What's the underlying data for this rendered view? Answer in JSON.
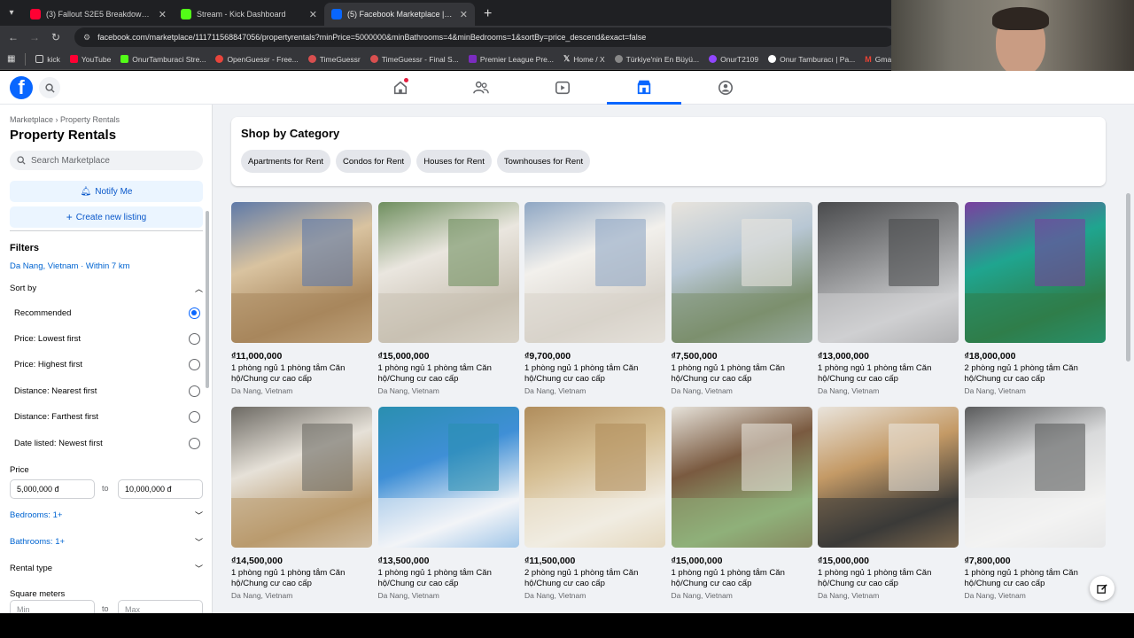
{
  "browser": {
    "tabs": [
      {
        "title": "(3) Fallout S2E5 Breakdown of T",
        "favicon_color": "#ff0033",
        "active": false
      },
      {
        "title": "Stream - Kick Dashboard",
        "favicon_color": "#53fc18",
        "active": false
      },
      {
        "title": "(5) Facebook Marketplace | Fac",
        "favicon_color": "#0866ff",
        "active": true
      }
    ],
    "url": "facebook.com/marketplace/111711568847056/propertyrentals?minPrice=5000000&minBathrooms=4&minBedrooms=1&sortBy=price_descend&exact=false",
    "bookmarks": [
      {
        "label": "kick",
        "color": "#53fc18"
      },
      {
        "label": "YouTube",
        "color": "#ff0033"
      },
      {
        "label": "OnurTamburaci Stre...",
        "color": "#53fc18"
      },
      {
        "label": "OpenGuessr - Free...",
        "color": "#e8453c"
      },
      {
        "label": "TimeGuessr",
        "color": "#d94f4f"
      },
      {
        "label": "TimeGuessr - Final S...",
        "color": "#d94f4f"
      },
      {
        "label": "Premier League Pre...",
        "color": "#7b2cbf"
      },
      {
        "label": "Home / X",
        "color": "#000000"
      },
      {
        "label": "Türkiye'nin En Büyü...",
        "color": "#888888"
      },
      {
        "label": "OnurT2109",
        "color": "#9146ff"
      },
      {
        "label": "Onur Tamburacı | Pa...",
        "color": "#000000"
      },
      {
        "label": "Gmail",
        "color": "#ea4335"
      }
    ]
  },
  "sidebar": {
    "breadcrumb": "Marketplace › Property Rentals",
    "title": "Property Rentals",
    "search_placeholder": "Search Marketplace",
    "notify_label": "Notify Me",
    "create_label": "Create new listing",
    "filters_label": "Filters",
    "location": "Da Nang, Vietnam · Within 7 km",
    "sort_label": "Sort by",
    "sort_options": [
      {
        "label": "Recommended",
        "selected": true
      },
      {
        "label": "Price: Lowest first",
        "selected": false
      },
      {
        "label": "Price: Highest first",
        "selected": false
      },
      {
        "label": "Distance: Nearest first",
        "selected": false
      },
      {
        "label": "Distance: Farthest first",
        "selected": false
      },
      {
        "label": "Date listed: Newest first",
        "selected": false
      }
    ],
    "price_label": "Price",
    "price_min": "5,000,000 đ",
    "price_to": "to",
    "price_max": "10,000,000 đ",
    "bedrooms": "Bedrooms: 1+",
    "bathrooms": "Bathrooms: 1+",
    "rental_type": "Rental type",
    "square_meters": "Square meters",
    "sqm_min": "Min",
    "sqm_to": "to",
    "sqm_max": "Max"
  },
  "category": {
    "title": "Shop by Category",
    "chips": [
      "Apartments for Rent",
      "Condos for Rent",
      "Houses for Rent",
      "Townhouses for Rent"
    ]
  },
  "listings": [
    {
      "price": "₫11,000,000",
      "title": "1 phòng ngủ 1 phòng tắm Căn hộ/Chung cư cao cấp",
      "location": "Da Nang, Vietnam",
      "colors": [
        "#d9c3a0",
        "#a8865c",
        "#5f7aa8"
      ]
    },
    {
      "price": "₫15,000,000",
      "title": "1 phòng ngủ 1 phòng tắm Căn hộ/Chung cư cao cấp",
      "location": "Da Nang, Vietnam",
      "colors": [
        "#eae6df",
        "#c9c1b3",
        "#6f8f5f"
      ]
    },
    {
      "price": "₫9,700,000",
      "title": "1 phòng ngủ 1 phòng tắm Căn hộ/Chung cư cao cấp",
      "location": "Da Nang, Vietnam",
      "colors": [
        "#f2f0ec",
        "#d8d3cb",
        "#8fa7c4"
      ]
    },
    {
      "price": "₫7,500,000",
      "title": "1 phòng ngủ 1 phòng tắm Căn hộ/Chung cư cao cấp",
      "location": "Da Nang, Vietnam",
      "colors": [
        "#b8c7d4",
        "#7c8f6e",
        "#e8e4dd"
      ]
    },
    {
      "price": "₫13,000,000",
      "title": "1 phòng ngủ 1 phòng tắm Căn hộ/Chung cư cao cấp",
      "location": "Da Nang, Vietnam",
      "colors": [
        "#8b8c8e",
        "#cfd0d2",
        "#4a4b4d"
      ]
    },
    {
      "price": "₫18,000,000",
      "title": "2 phòng ngủ 1 phòng tắm Căn hộ/Chung cư cao cấp",
      "location": "Da Nang, Vietnam",
      "colors": [
        "#1fa58f",
        "#2f7d4a",
        "#7a3fa0"
      ]
    },
    {
      "price": "₫14,500,000",
      "title": "1 phòng ngủ 1 phòng tắm Căn hộ/Chung cư cao cấp",
      "location": "Da Nang, Vietnam",
      "colors": [
        "#e6e1d8",
        "#b99a6e",
        "#6d6a64"
      ]
    },
    {
      "price": "₫13,500,000",
      "title": "1 phòng ngủ 1 phòng tắm Căn hộ/Chung cư cao cấp",
      "location": "Da Nang, Vietnam",
      "colors": [
        "#3f8fd6",
        "#f2f4f7",
        "#2a8fb0"
      ]
    },
    {
      "price": "₫11,500,000",
      "title": "2 phòng ngủ 1 phòng tắm Căn hộ/Chung cư cao cấp",
      "location": "Da Nang, Vietnam",
      "colors": [
        "#d6bf94",
        "#f1ece2",
        "#b08d5c"
      ]
    },
    {
      "price": "₫15,000,000",
      "title": "1 phòng ngủ 1 phòng tắm Căn hộ/Chung cư cao cấp",
      "location": "Da Nang, Vietnam",
      "colors": [
        "#7a5a40",
        "#8fb07a",
        "#e6e2da"
      ]
    },
    {
      "price": "₫15,000,000",
      "title": "1 phòng ngủ 1 phòng tắm Căn hộ/Chung cư cao cấp",
      "location": "Da Nang, Vietnam",
      "colors": [
        "#c49a66",
        "#3b3a38",
        "#e9e4dc"
      ]
    },
    {
      "price": "₫7,800,000",
      "title": "1 phòng ngủ 1 phòng tắm Căn hộ/Chung cư cao cấp",
      "location": "Da Nang, Vietnam",
      "colors": [
        "#d9dadb",
        "#f3f3f2",
        "#5a5b5c"
      ]
    }
  ]
}
